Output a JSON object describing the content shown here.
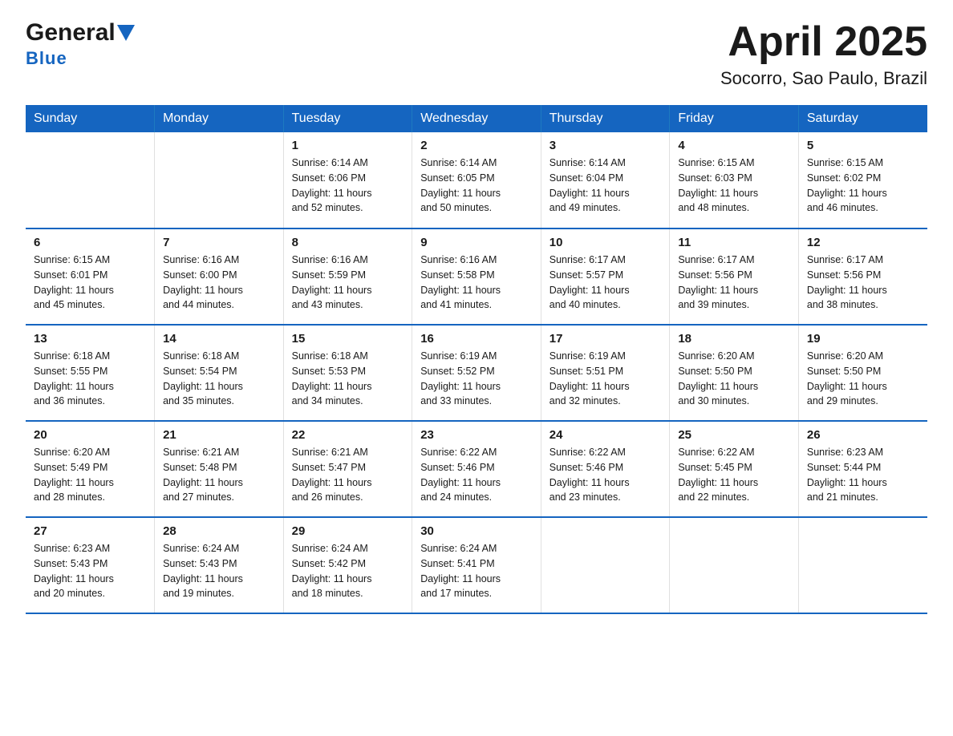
{
  "header": {
    "logo_general": "General",
    "logo_blue": "Blue",
    "month_title": "April 2025",
    "location": "Socorro, Sao Paulo, Brazil"
  },
  "weekdays": [
    "Sunday",
    "Monday",
    "Tuesday",
    "Wednesday",
    "Thursday",
    "Friday",
    "Saturday"
  ],
  "weeks": [
    [
      {
        "num": "",
        "sunrise": "",
        "sunset": "",
        "daylight": ""
      },
      {
        "num": "",
        "sunrise": "",
        "sunset": "",
        "daylight": ""
      },
      {
        "num": "1",
        "sunrise": "Sunrise: 6:14 AM",
        "sunset": "Sunset: 6:06 PM",
        "daylight": "Daylight: 11 hours and 52 minutes."
      },
      {
        "num": "2",
        "sunrise": "Sunrise: 6:14 AM",
        "sunset": "Sunset: 6:05 PM",
        "daylight": "Daylight: 11 hours and 50 minutes."
      },
      {
        "num": "3",
        "sunrise": "Sunrise: 6:14 AM",
        "sunset": "Sunset: 6:04 PM",
        "daylight": "Daylight: 11 hours and 49 minutes."
      },
      {
        "num": "4",
        "sunrise": "Sunrise: 6:15 AM",
        "sunset": "Sunset: 6:03 PM",
        "daylight": "Daylight: 11 hours and 48 minutes."
      },
      {
        "num": "5",
        "sunrise": "Sunrise: 6:15 AM",
        "sunset": "Sunset: 6:02 PM",
        "daylight": "Daylight: 11 hours and 46 minutes."
      }
    ],
    [
      {
        "num": "6",
        "sunrise": "Sunrise: 6:15 AM",
        "sunset": "Sunset: 6:01 PM",
        "daylight": "Daylight: 11 hours and 45 minutes."
      },
      {
        "num": "7",
        "sunrise": "Sunrise: 6:16 AM",
        "sunset": "Sunset: 6:00 PM",
        "daylight": "Daylight: 11 hours and 44 minutes."
      },
      {
        "num": "8",
        "sunrise": "Sunrise: 6:16 AM",
        "sunset": "Sunset: 5:59 PM",
        "daylight": "Daylight: 11 hours and 43 minutes."
      },
      {
        "num": "9",
        "sunrise": "Sunrise: 6:16 AM",
        "sunset": "Sunset: 5:58 PM",
        "daylight": "Daylight: 11 hours and 41 minutes."
      },
      {
        "num": "10",
        "sunrise": "Sunrise: 6:17 AM",
        "sunset": "Sunset: 5:57 PM",
        "daylight": "Daylight: 11 hours and 40 minutes."
      },
      {
        "num": "11",
        "sunrise": "Sunrise: 6:17 AM",
        "sunset": "Sunset: 5:56 PM",
        "daylight": "Daylight: 11 hours and 39 minutes."
      },
      {
        "num": "12",
        "sunrise": "Sunrise: 6:17 AM",
        "sunset": "Sunset: 5:56 PM",
        "daylight": "Daylight: 11 hours and 38 minutes."
      }
    ],
    [
      {
        "num": "13",
        "sunrise": "Sunrise: 6:18 AM",
        "sunset": "Sunset: 5:55 PM",
        "daylight": "Daylight: 11 hours and 36 minutes."
      },
      {
        "num": "14",
        "sunrise": "Sunrise: 6:18 AM",
        "sunset": "Sunset: 5:54 PM",
        "daylight": "Daylight: 11 hours and 35 minutes."
      },
      {
        "num": "15",
        "sunrise": "Sunrise: 6:18 AM",
        "sunset": "Sunset: 5:53 PM",
        "daylight": "Daylight: 11 hours and 34 minutes."
      },
      {
        "num": "16",
        "sunrise": "Sunrise: 6:19 AM",
        "sunset": "Sunset: 5:52 PM",
        "daylight": "Daylight: 11 hours and 33 minutes."
      },
      {
        "num": "17",
        "sunrise": "Sunrise: 6:19 AM",
        "sunset": "Sunset: 5:51 PM",
        "daylight": "Daylight: 11 hours and 32 minutes."
      },
      {
        "num": "18",
        "sunrise": "Sunrise: 6:20 AM",
        "sunset": "Sunset: 5:50 PM",
        "daylight": "Daylight: 11 hours and 30 minutes."
      },
      {
        "num": "19",
        "sunrise": "Sunrise: 6:20 AM",
        "sunset": "Sunset: 5:50 PM",
        "daylight": "Daylight: 11 hours and 29 minutes."
      }
    ],
    [
      {
        "num": "20",
        "sunrise": "Sunrise: 6:20 AM",
        "sunset": "Sunset: 5:49 PM",
        "daylight": "Daylight: 11 hours and 28 minutes."
      },
      {
        "num": "21",
        "sunrise": "Sunrise: 6:21 AM",
        "sunset": "Sunset: 5:48 PM",
        "daylight": "Daylight: 11 hours and 27 minutes."
      },
      {
        "num": "22",
        "sunrise": "Sunrise: 6:21 AM",
        "sunset": "Sunset: 5:47 PM",
        "daylight": "Daylight: 11 hours and 26 minutes."
      },
      {
        "num": "23",
        "sunrise": "Sunrise: 6:22 AM",
        "sunset": "Sunset: 5:46 PM",
        "daylight": "Daylight: 11 hours and 24 minutes."
      },
      {
        "num": "24",
        "sunrise": "Sunrise: 6:22 AM",
        "sunset": "Sunset: 5:46 PM",
        "daylight": "Daylight: 11 hours and 23 minutes."
      },
      {
        "num": "25",
        "sunrise": "Sunrise: 6:22 AM",
        "sunset": "Sunset: 5:45 PM",
        "daylight": "Daylight: 11 hours and 22 minutes."
      },
      {
        "num": "26",
        "sunrise": "Sunrise: 6:23 AM",
        "sunset": "Sunset: 5:44 PM",
        "daylight": "Daylight: 11 hours and 21 minutes."
      }
    ],
    [
      {
        "num": "27",
        "sunrise": "Sunrise: 6:23 AM",
        "sunset": "Sunset: 5:43 PM",
        "daylight": "Daylight: 11 hours and 20 minutes."
      },
      {
        "num": "28",
        "sunrise": "Sunrise: 6:24 AM",
        "sunset": "Sunset: 5:43 PM",
        "daylight": "Daylight: 11 hours and 19 minutes."
      },
      {
        "num": "29",
        "sunrise": "Sunrise: 6:24 AM",
        "sunset": "Sunset: 5:42 PM",
        "daylight": "Daylight: 11 hours and 18 minutes."
      },
      {
        "num": "30",
        "sunrise": "Sunrise: 6:24 AM",
        "sunset": "Sunset: 5:41 PM",
        "daylight": "Daylight: 11 hours and 17 minutes."
      },
      {
        "num": "",
        "sunrise": "",
        "sunset": "",
        "daylight": ""
      },
      {
        "num": "",
        "sunrise": "",
        "sunset": "",
        "daylight": ""
      },
      {
        "num": "",
        "sunrise": "",
        "sunset": "",
        "daylight": ""
      }
    ]
  ]
}
